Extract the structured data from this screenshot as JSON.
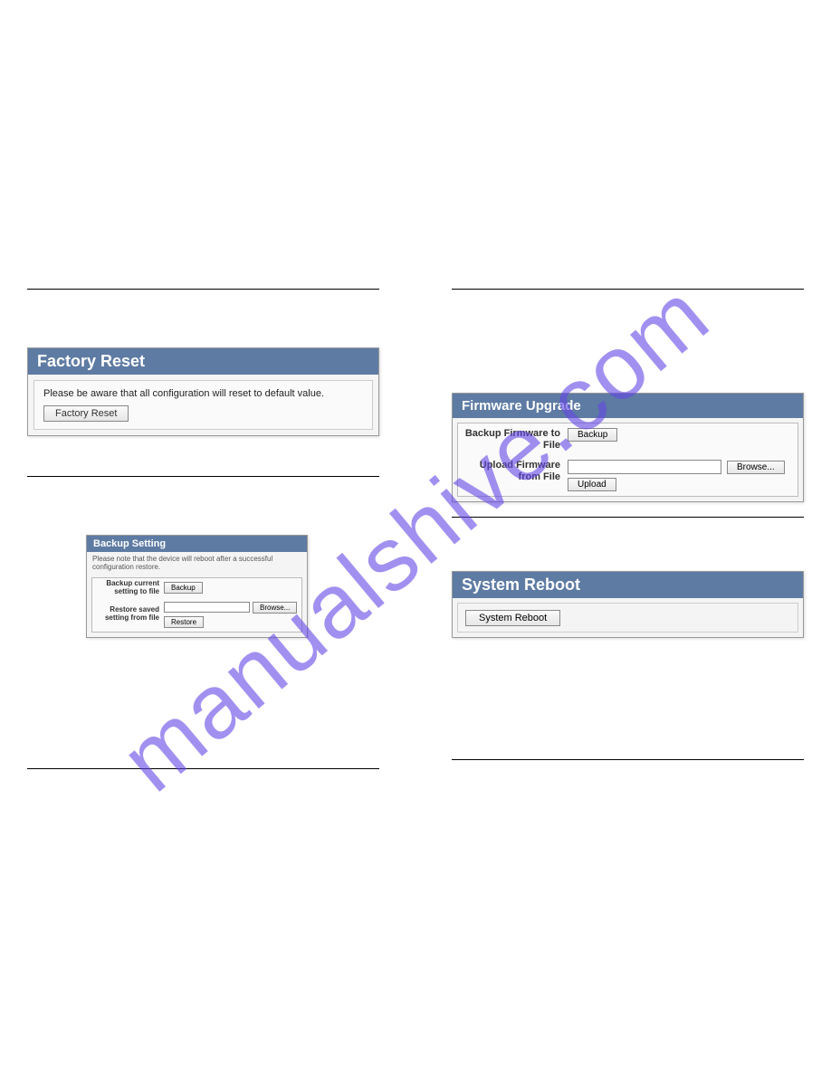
{
  "watermark": "manualshive.com",
  "factory_reset": {
    "title": "Factory Reset",
    "message": "Please be aware that all configuration will reset to default value.",
    "button": "Factory Reset"
  },
  "backup_setting": {
    "title": "Backup Setting",
    "note": "Please note that the device will reboot after a successful configuration restore.",
    "row1_label": "Backup current setting to file",
    "row1_button": "Backup",
    "row2_label": "Restore saved setting from file",
    "row2_browse": "Browse...",
    "row2_button": "Restore"
  },
  "firmware_upgrade": {
    "title": "Firmware Upgrade",
    "row1_label": "Backup Firmware to File",
    "row1_button": "Backup",
    "row2_label": "Upload Firmware from File",
    "row2_browse": "Browse...",
    "row2_button": "Upload"
  },
  "system_reboot": {
    "title": "System Reboot",
    "button": "System Reboot"
  }
}
